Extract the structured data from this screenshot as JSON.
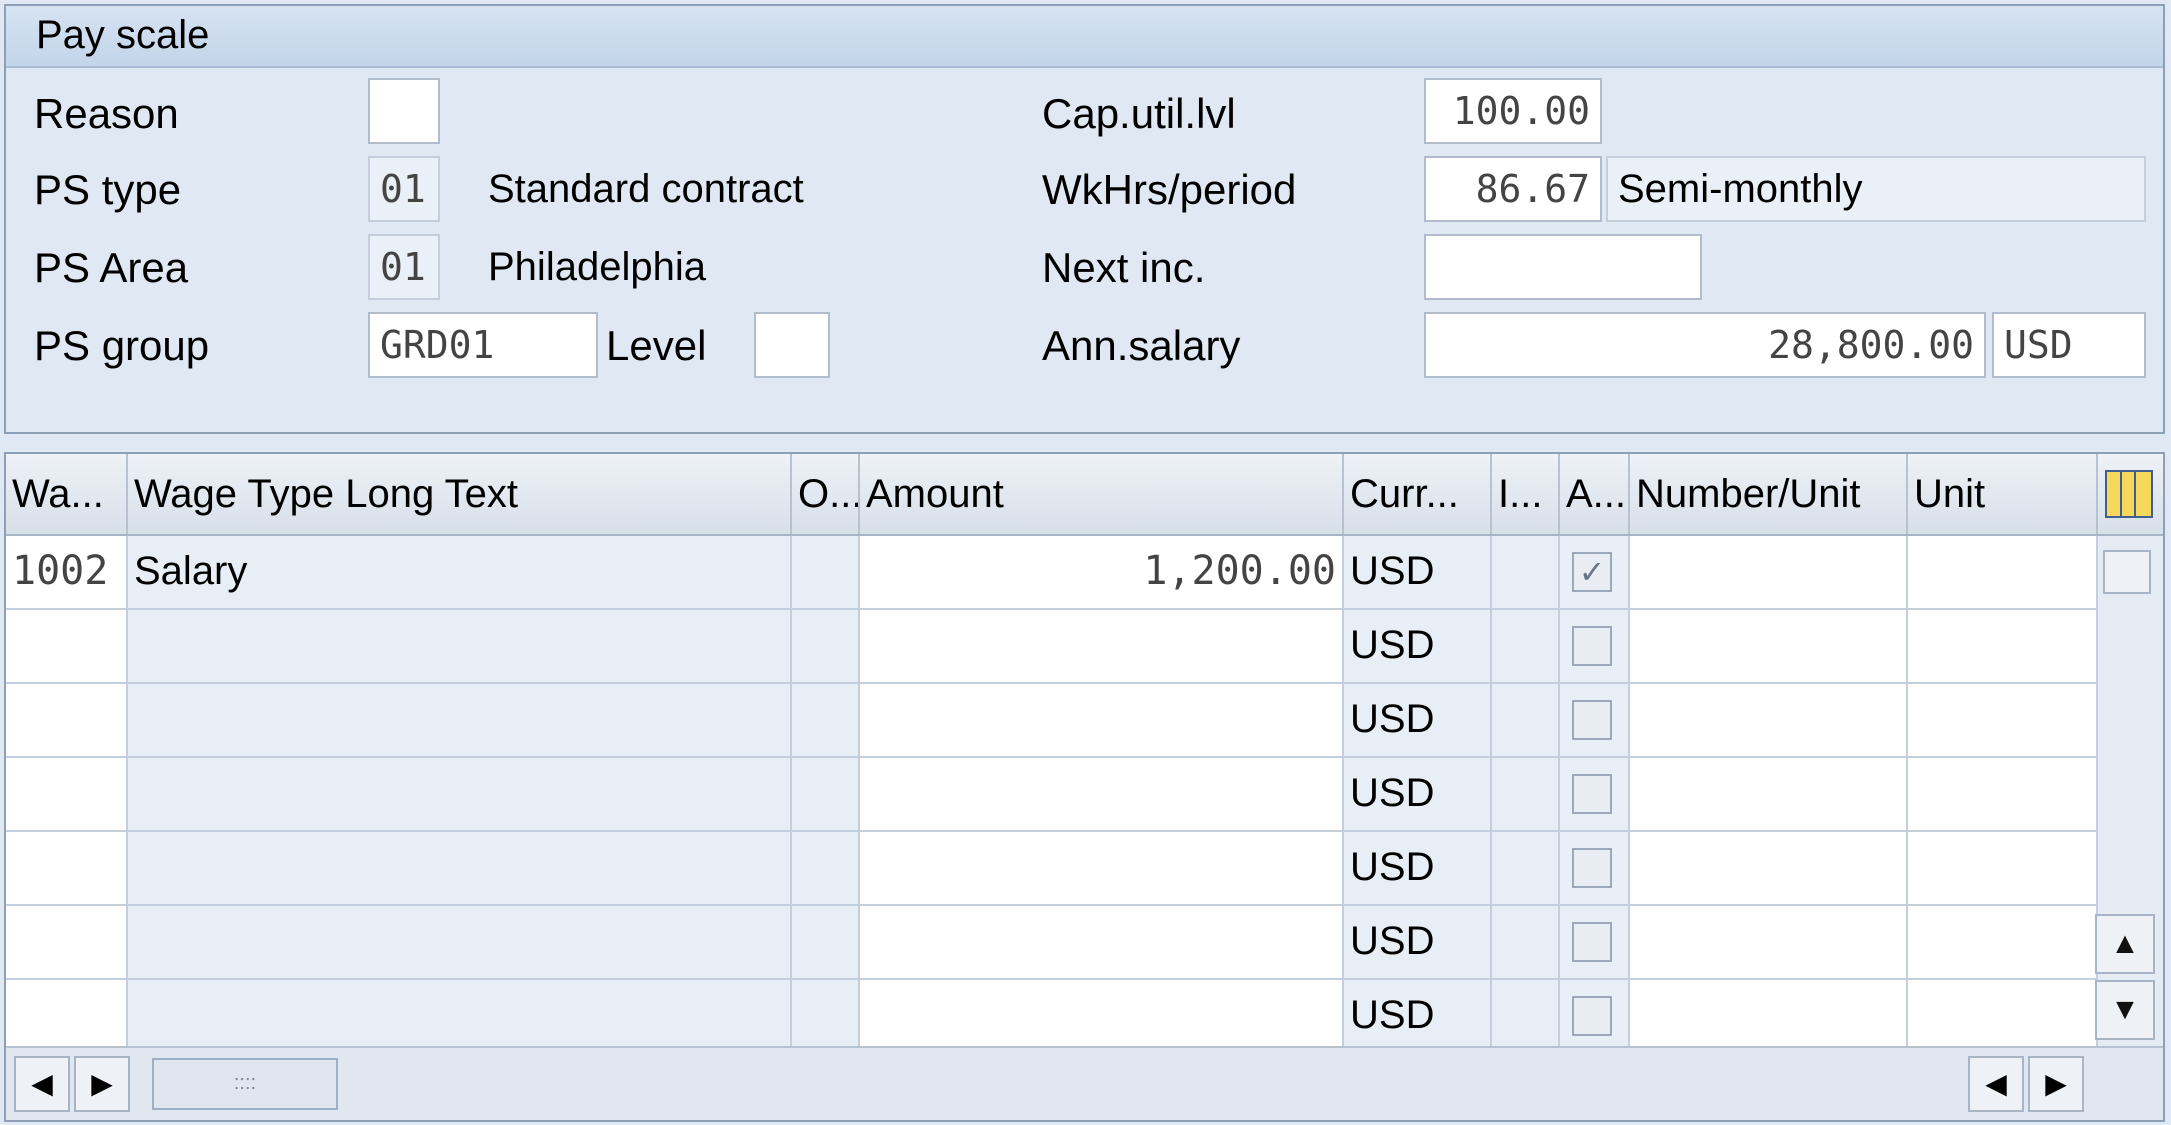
{
  "pay_scale": {
    "title": "Pay scale",
    "reason": {
      "label": "Reason",
      "value": ""
    },
    "ps_type": {
      "label": "PS type",
      "code": "01",
      "text": "Standard contract"
    },
    "ps_area": {
      "label": "PS Area",
      "code": "01",
      "text": "Philadelphia"
    },
    "ps_group": {
      "label": "PS group",
      "value": "GRD01",
      "level_label": "Level",
      "level_value": ""
    },
    "cap_util": {
      "label": "Cap.util.lvl",
      "value": "100.00"
    },
    "wkhrs": {
      "label": "WkHrs/period",
      "value": "86.67",
      "text": "Semi-monthly"
    },
    "next_inc": {
      "label": "Next inc.",
      "value": ""
    },
    "ann_salary": {
      "label": "Ann.salary",
      "value": "28,800.00",
      "currency": "USD"
    }
  },
  "table": {
    "columns": [
      "Wa...",
      "Wage Type Long Text",
      "O...",
      "Amount",
      "Curr...",
      "I...",
      "A...",
      "Number/Unit",
      "Unit"
    ],
    "rows": [
      {
        "wage_type": "1002",
        "long_text": "Salary",
        "op": "",
        "amount": "1,200.00",
        "currency": "USD",
        "ind": "",
        "assign": "✓",
        "number": "",
        "unit": ""
      },
      {
        "wage_type": "",
        "long_text": "",
        "op": "",
        "amount": "",
        "currency": "USD",
        "ind": "",
        "assign": "",
        "number": "",
        "unit": ""
      },
      {
        "wage_type": "",
        "long_text": "",
        "op": "",
        "amount": "",
        "currency": "USD",
        "ind": "",
        "assign": "",
        "number": "",
        "unit": ""
      },
      {
        "wage_type": "",
        "long_text": "",
        "op": "",
        "amount": "",
        "currency": "USD",
        "ind": "",
        "assign": "",
        "number": "",
        "unit": ""
      },
      {
        "wage_type": "",
        "long_text": "",
        "op": "",
        "amount": "",
        "currency": "USD",
        "ind": "",
        "assign": "",
        "number": "",
        "unit": ""
      },
      {
        "wage_type": "",
        "long_text": "",
        "op": "",
        "amount": "",
        "currency": "USD",
        "ind": "",
        "assign": "",
        "number": "",
        "unit": ""
      },
      {
        "wage_type": "",
        "long_text": "",
        "op": "",
        "amount": "",
        "currency": "USD",
        "ind": "",
        "assign": "",
        "number": "",
        "unit": ""
      }
    ],
    "config_icon": "table-settings-icon",
    "scroll": {
      "thumb_glyph": "::::",
      "left_glyph": "◀",
      "right_glyph": "▶",
      "up_glyph": "▲",
      "down_glyph": "▼"
    }
  }
}
